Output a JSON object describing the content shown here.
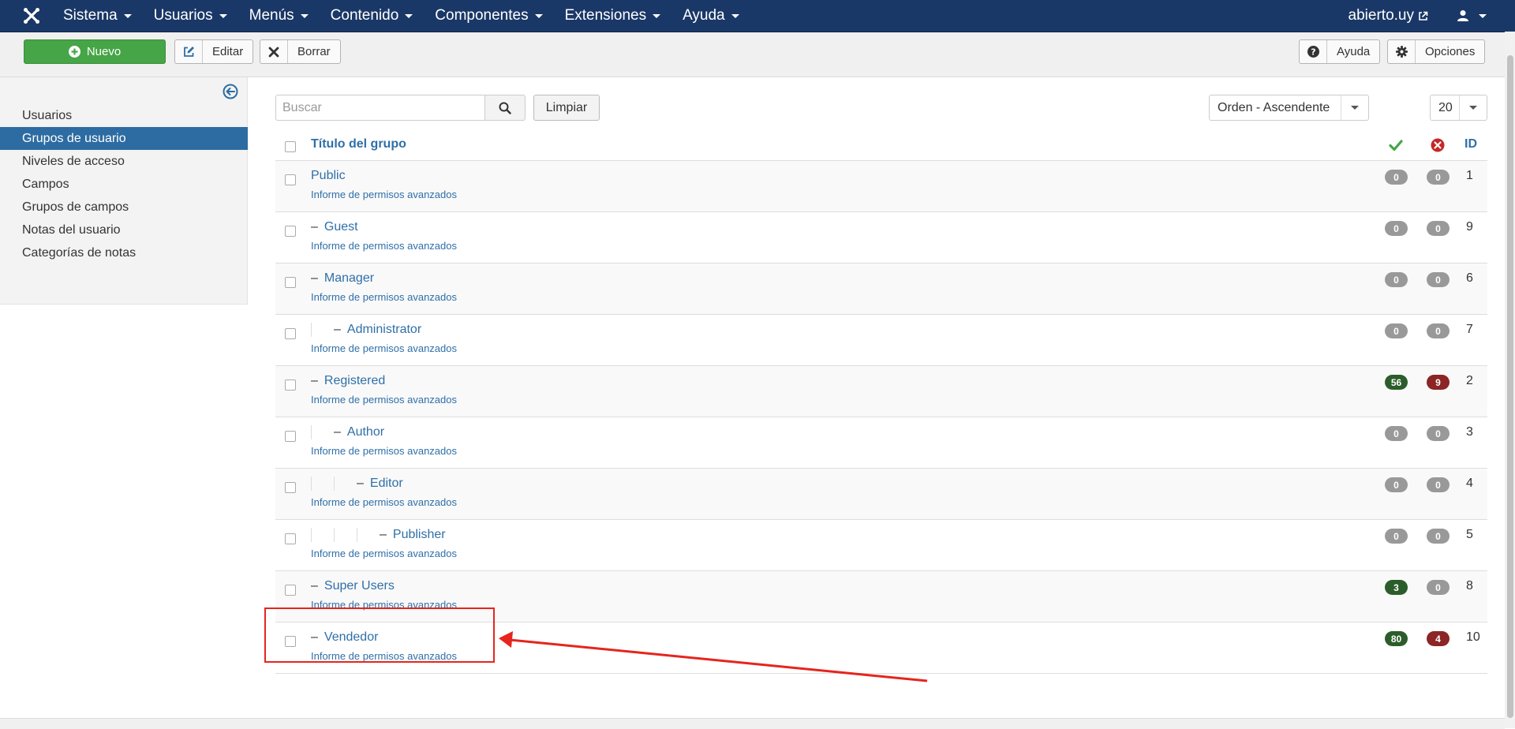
{
  "navbar": {
    "menus": [
      "Sistema",
      "Usuarios",
      "Menús",
      "Contenido",
      "Componentes",
      "Extensiones",
      "Ayuda"
    ],
    "site_name": "abierto.uy"
  },
  "toolbar": {
    "new_label": "Nuevo",
    "edit_label": "Editar",
    "delete_label": "Borrar",
    "help_label": "Ayuda",
    "options_label": "Opciones"
  },
  "sidebar": {
    "items": [
      "Usuarios",
      "Grupos de usuario",
      "Niveles de acceso",
      "Campos",
      "Grupos de campos",
      "Notas del usuario",
      "Categorías de notas"
    ],
    "active_index": 1
  },
  "filters": {
    "search_placeholder": "Buscar",
    "clear_label": "Limpiar",
    "order_value": "Orden - Ascendente",
    "limit_value": "20"
  },
  "table": {
    "header_title": "Título del grupo",
    "header_id": "ID",
    "permissions_link": "Informe de permisos avanzados",
    "rows": [
      {
        "title": "Public",
        "level": 0,
        "enabled": "0",
        "blocked": "0",
        "id": "1"
      },
      {
        "title": "Guest",
        "level": 1,
        "enabled": "0",
        "blocked": "0",
        "id": "9"
      },
      {
        "title": "Manager",
        "level": 1,
        "enabled": "0",
        "blocked": "0",
        "id": "6"
      },
      {
        "title": "Administrator",
        "level": 2,
        "enabled": "0",
        "blocked": "0",
        "id": "7"
      },
      {
        "title": "Registered",
        "level": 1,
        "enabled": "56",
        "blocked": "9",
        "id": "2"
      },
      {
        "title": "Author",
        "level": 2,
        "enabled": "0",
        "blocked": "0",
        "id": "3"
      },
      {
        "title": "Editor",
        "level": 3,
        "enabled": "0",
        "blocked": "0",
        "id": "4"
      },
      {
        "title": "Publisher",
        "level": 4,
        "enabled": "0",
        "blocked": "0",
        "id": "5"
      },
      {
        "title": "Super Users",
        "level": 1,
        "enabled": "3",
        "blocked": "0",
        "id": "8"
      },
      {
        "title": "Vendedor",
        "level": 1,
        "enabled": "80",
        "blocked": "4",
        "id": "10"
      }
    ]
  },
  "colors": {
    "navbar": "#1a3867",
    "link": "#2f6fa8",
    "new_button": "#46a546",
    "badge_success": "#2b5d2a",
    "badge_danger": "#8c2525",
    "badge_neutral": "#999999",
    "annotation": "#e5251e"
  }
}
